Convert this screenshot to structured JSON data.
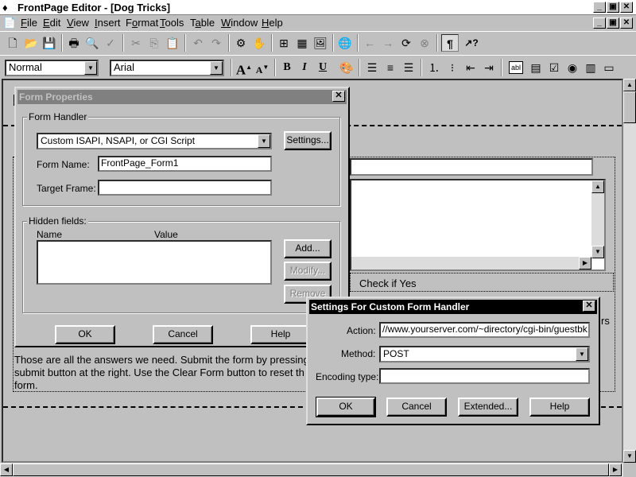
{
  "window": {
    "title": "FrontPage Editor - [Dog Tricks]",
    "controls": [
      "_",
      "▣",
      "✕"
    ],
    "doc_controls": [
      "_",
      "▣",
      "✕"
    ]
  },
  "menubar": {
    "items": [
      {
        "label": "File",
        "hotkey": "F"
      },
      {
        "label": "Edit",
        "hotkey": "E"
      },
      {
        "label": "View",
        "hotkey": "V"
      },
      {
        "label": "Insert",
        "hotkey": "I"
      },
      {
        "label": "Format",
        "hotkey": "o"
      },
      {
        "label": "Tools",
        "hotkey": "T"
      },
      {
        "label": "Table",
        "hotkey": "a"
      },
      {
        "label": "Window",
        "hotkey": "W"
      },
      {
        "label": "Help",
        "hotkey": "H"
      }
    ]
  },
  "toolbar": {
    "style_value": "Normal",
    "font_value": "Arial",
    "bold": "B",
    "italic": "I",
    "underline": "U",
    "pilcrow": "¶",
    "help_tool": "↗?",
    "textbox_tool": "abl",
    "increase_font": "A",
    "decrease_font": "A"
  },
  "editor": {
    "check_if_yes": "Check if Yes",
    "partial_text": "rs",
    "body_text": "Those are all the answers we need. Submit the form by pressing submit button at the right. Use the Clear Form button to reset th form."
  },
  "form_properties": {
    "title": "Form Properties",
    "form_handler_group": "Form Handler",
    "handler_value": "Custom ISAPI, NSAPI, or CGI Script",
    "settings_button": "Settings...",
    "form_name_label": "Form Name:",
    "form_name_value": "FrontPage_Form1",
    "target_frame_label": "Target Frame:",
    "target_frame_value": "",
    "hidden_fields_group": "Hidden fields:",
    "col_name": "Name",
    "col_value": "Value",
    "add_button": "Add...",
    "modify_button": "Modify...",
    "remove_button": "Remove",
    "ok_button": "OK",
    "cancel_button": "Cancel",
    "help_button": "Help"
  },
  "custom_handler": {
    "title": "Settings For Custom Form Handler",
    "action_label": "Action:",
    "action_value": "//www.yourserver.com/~directory/cgi-bin/guestbk.cgi",
    "method_label": "Method:",
    "method_value": "POST",
    "encoding_label": "Encoding type:",
    "encoding_value": "",
    "ok_button": "OK",
    "cancel_button": "Cancel",
    "extended_button": "Extended...",
    "help_button": "Help"
  },
  "colors": {
    "dialog_face": "#c0c0c0",
    "active_title": "#000000",
    "inactive_title": "#808080"
  }
}
